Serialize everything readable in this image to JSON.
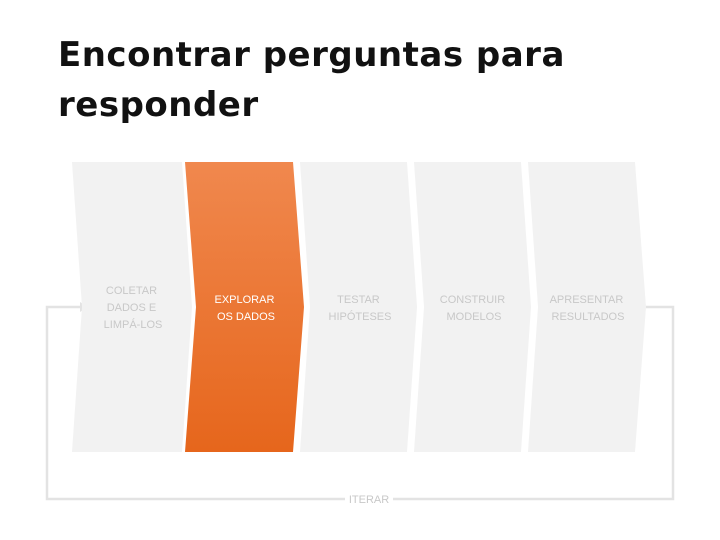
{
  "title": "Encontrar perguntas para responder",
  "colors": {
    "inactive_fill": "#f2f2f2",
    "inactive_text": "#c8c8c8",
    "active_fill_top": "#f0884e",
    "active_fill_bottom": "#e6661c",
    "active_text": "#ffffff",
    "loop_line": "#e3e3e3",
    "loop_text": "#c8c8c8"
  },
  "steps": [
    {
      "id": "coletar",
      "lines": [
        "COLETAR",
        "DADOS E",
        "LIMPÁ-LOS"
      ],
      "active": false
    },
    {
      "id": "explorar",
      "lines": [
        "EXPLORAR",
        "OS DADOS"
      ],
      "active": true
    },
    {
      "id": "testar",
      "lines": [
        "TESTAR",
        "HIPÓTESES"
      ],
      "active": false
    },
    {
      "id": "construir",
      "lines": [
        "CONSTRUIR",
        "MODELOS"
      ],
      "active": false
    },
    {
      "id": "apresentar",
      "lines": [
        "APRESENTAR",
        "RESULTADOS"
      ],
      "active": false
    }
  ],
  "loop": {
    "label": "ITERAR",
    "arrow": "arrow-right-icon"
  }
}
